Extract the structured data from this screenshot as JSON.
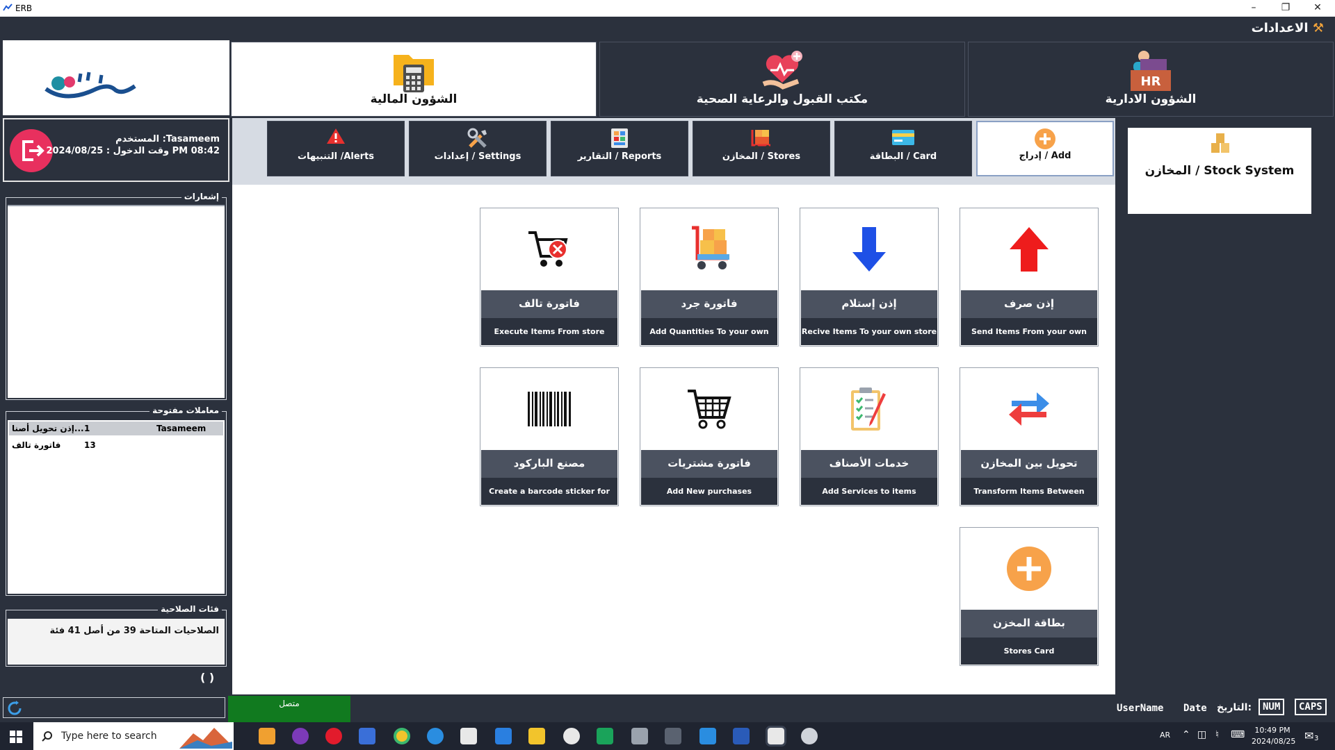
{
  "window": {
    "title": "ERB"
  },
  "header": {
    "settings_label": "الاعدادات"
  },
  "modules": [
    {
      "label": "الشؤون الادارية",
      "icon": "hr-icon"
    },
    {
      "label": "مكتب القبول والرعاية الصحية",
      "icon": "health-care-icon"
    },
    {
      "label": "الشؤون المالية",
      "icon": "calculator-folder-icon"
    }
  ],
  "user": {
    "user_line": "المستخدم :Tasameem",
    "login_line": "وقت الدخول : 2024/08/25 PM 08:42"
  },
  "toolbar": {
    "items": [
      {
        "label": "إدراج / Add",
        "icon": "plus-circle-icon"
      },
      {
        "label": "البطاقة / Card",
        "icon": "card-icon"
      },
      {
        "label": "المخازن / Stores",
        "icon": "stores-icon"
      },
      {
        "label": "التقارير / Reports",
        "icon": "reports-icon"
      },
      {
        "label": "إعدادات / Settings",
        "icon": "tools-icon"
      },
      {
        "label": "التنبيهات /Alerts",
        "icon": "warning-icon"
      }
    ]
  },
  "stock_system": {
    "label": "المخازن / Stock System"
  },
  "notifications": {
    "title": "إشعارات"
  },
  "open_transactions": {
    "title": "معاملات مفتوحة",
    "rows": [
      {
        "name": "إذن تحويل أصنا...",
        "num": "1",
        "user": "Tasameem"
      },
      {
        "name": "فاتورة تالف",
        "num": "13",
        "user": ""
      }
    ]
  },
  "permissions": {
    "title": "فئات الصلاحية",
    "text": "الصلاحيات المتاحة 39 من أصل 41 فئة",
    "parens": "( )"
  },
  "cards": [
    {
      "title": "إذن صرف",
      "sub": "Send Items From your own store",
      "icon": "up-arrow-icon"
    },
    {
      "title": "إذن إستلام",
      "sub": "Recive Items To your own store",
      "icon": "down-arrow-icon"
    },
    {
      "title": "فاتورة جرد",
      "sub": "Add Quantities To your own store",
      "icon": "inventory-cart-icon"
    },
    {
      "title": "فاتورة تالف",
      "sub": "Execute Items From store",
      "icon": "damaged-cart-icon"
    },
    {
      "title": "تحويل بين المخازن",
      "sub": "Transform Items Between Stores",
      "icon": "transfer-arrows-icon"
    },
    {
      "title": "خدمات الأصناف",
      "sub": "Add Services to items",
      "icon": "checklist-icon"
    },
    {
      "title": "فاتورة مشتريات",
      "sub": "Add New purchases",
      "icon": "shopping-cart-icon"
    },
    {
      "title": "مصنع الباركود",
      "sub": "Create a barcode sticker for items",
      "icon": "barcode-icon"
    },
    {
      "title": "بطاقة المخزن",
      "sub": "Stores Card",
      "icon": "plus-circle-icon"
    }
  ],
  "status": {
    "connected": "متصل",
    "username": "UserName",
    "date": "Date",
    "date_ar": "التاريخ:",
    "num": "NUM",
    "caps": "CAPS"
  },
  "taskbar": {
    "search_placeholder": "Type here to search",
    "lang": "AR",
    "time": "10:49 PM",
    "date": "2024/08/25",
    "notif_count": "3"
  },
  "colors": {
    "dark": "#2b313d",
    "accent_green": "#117a1f",
    "orange": "#f7a24a",
    "red": "#e8302e",
    "blue": "#1e5bd6"
  }
}
